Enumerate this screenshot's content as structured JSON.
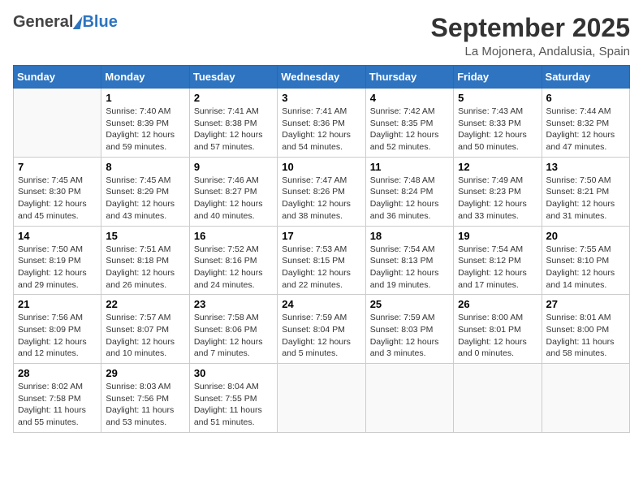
{
  "header": {
    "logo_general": "General",
    "logo_blue": "Blue",
    "title": "September 2025",
    "subtitle": "La Mojonera, Andalusia, Spain"
  },
  "calendar": {
    "days_of_week": [
      "Sunday",
      "Monday",
      "Tuesday",
      "Wednesday",
      "Thursday",
      "Friday",
      "Saturday"
    ],
    "weeks": [
      [
        {
          "date": "",
          "info": ""
        },
        {
          "date": "1",
          "info": "Sunrise: 7:40 AM\nSunset: 8:39 PM\nDaylight: 12 hours\nand 59 minutes."
        },
        {
          "date": "2",
          "info": "Sunrise: 7:41 AM\nSunset: 8:38 PM\nDaylight: 12 hours\nand 57 minutes."
        },
        {
          "date": "3",
          "info": "Sunrise: 7:41 AM\nSunset: 8:36 PM\nDaylight: 12 hours\nand 54 minutes."
        },
        {
          "date": "4",
          "info": "Sunrise: 7:42 AM\nSunset: 8:35 PM\nDaylight: 12 hours\nand 52 minutes."
        },
        {
          "date": "5",
          "info": "Sunrise: 7:43 AM\nSunset: 8:33 PM\nDaylight: 12 hours\nand 50 minutes."
        },
        {
          "date": "6",
          "info": "Sunrise: 7:44 AM\nSunset: 8:32 PM\nDaylight: 12 hours\nand 47 minutes."
        }
      ],
      [
        {
          "date": "7",
          "info": "Sunrise: 7:45 AM\nSunset: 8:30 PM\nDaylight: 12 hours\nand 45 minutes."
        },
        {
          "date": "8",
          "info": "Sunrise: 7:45 AM\nSunset: 8:29 PM\nDaylight: 12 hours\nand 43 minutes."
        },
        {
          "date": "9",
          "info": "Sunrise: 7:46 AM\nSunset: 8:27 PM\nDaylight: 12 hours\nand 40 minutes."
        },
        {
          "date": "10",
          "info": "Sunrise: 7:47 AM\nSunset: 8:26 PM\nDaylight: 12 hours\nand 38 minutes."
        },
        {
          "date": "11",
          "info": "Sunrise: 7:48 AM\nSunset: 8:24 PM\nDaylight: 12 hours\nand 36 minutes."
        },
        {
          "date": "12",
          "info": "Sunrise: 7:49 AM\nSunset: 8:23 PM\nDaylight: 12 hours\nand 33 minutes."
        },
        {
          "date": "13",
          "info": "Sunrise: 7:50 AM\nSunset: 8:21 PM\nDaylight: 12 hours\nand 31 minutes."
        }
      ],
      [
        {
          "date": "14",
          "info": "Sunrise: 7:50 AM\nSunset: 8:19 PM\nDaylight: 12 hours\nand 29 minutes."
        },
        {
          "date": "15",
          "info": "Sunrise: 7:51 AM\nSunset: 8:18 PM\nDaylight: 12 hours\nand 26 minutes."
        },
        {
          "date": "16",
          "info": "Sunrise: 7:52 AM\nSunset: 8:16 PM\nDaylight: 12 hours\nand 24 minutes."
        },
        {
          "date": "17",
          "info": "Sunrise: 7:53 AM\nSunset: 8:15 PM\nDaylight: 12 hours\nand 22 minutes."
        },
        {
          "date": "18",
          "info": "Sunrise: 7:54 AM\nSunset: 8:13 PM\nDaylight: 12 hours\nand 19 minutes."
        },
        {
          "date": "19",
          "info": "Sunrise: 7:54 AM\nSunset: 8:12 PM\nDaylight: 12 hours\nand 17 minutes."
        },
        {
          "date": "20",
          "info": "Sunrise: 7:55 AM\nSunset: 8:10 PM\nDaylight: 12 hours\nand 14 minutes."
        }
      ],
      [
        {
          "date": "21",
          "info": "Sunrise: 7:56 AM\nSunset: 8:09 PM\nDaylight: 12 hours\nand 12 minutes."
        },
        {
          "date": "22",
          "info": "Sunrise: 7:57 AM\nSunset: 8:07 PM\nDaylight: 12 hours\nand 10 minutes."
        },
        {
          "date": "23",
          "info": "Sunrise: 7:58 AM\nSunset: 8:06 PM\nDaylight: 12 hours\nand 7 minutes."
        },
        {
          "date": "24",
          "info": "Sunrise: 7:59 AM\nSunset: 8:04 PM\nDaylight: 12 hours\nand 5 minutes."
        },
        {
          "date": "25",
          "info": "Sunrise: 7:59 AM\nSunset: 8:03 PM\nDaylight: 12 hours\nand 3 minutes."
        },
        {
          "date": "26",
          "info": "Sunrise: 8:00 AM\nSunset: 8:01 PM\nDaylight: 12 hours\nand 0 minutes."
        },
        {
          "date": "27",
          "info": "Sunrise: 8:01 AM\nSunset: 8:00 PM\nDaylight: 11 hours\nand 58 minutes."
        }
      ],
      [
        {
          "date": "28",
          "info": "Sunrise: 8:02 AM\nSunset: 7:58 PM\nDaylight: 11 hours\nand 55 minutes."
        },
        {
          "date": "29",
          "info": "Sunrise: 8:03 AM\nSunset: 7:56 PM\nDaylight: 11 hours\nand 53 minutes."
        },
        {
          "date": "30",
          "info": "Sunrise: 8:04 AM\nSunset: 7:55 PM\nDaylight: 11 hours\nand 51 minutes."
        },
        {
          "date": "",
          "info": ""
        },
        {
          "date": "",
          "info": ""
        },
        {
          "date": "",
          "info": ""
        },
        {
          "date": "",
          "info": ""
        }
      ]
    ]
  }
}
